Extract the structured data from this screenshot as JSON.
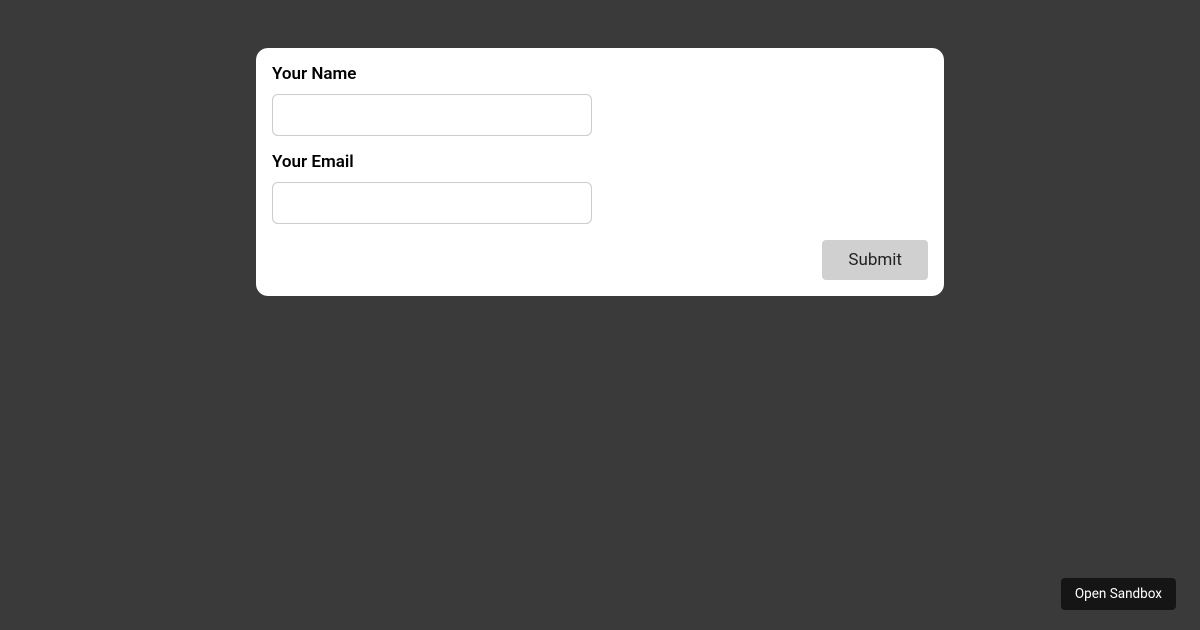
{
  "form": {
    "fields": [
      {
        "label": "Your Name",
        "value": ""
      },
      {
        "label": "Your Email",
        "value": ""
      }
    ],
    "submit_label": "Submit"
  },
  "footer": {
    "sandbox_label": "Open Sandbox"
  }
}
